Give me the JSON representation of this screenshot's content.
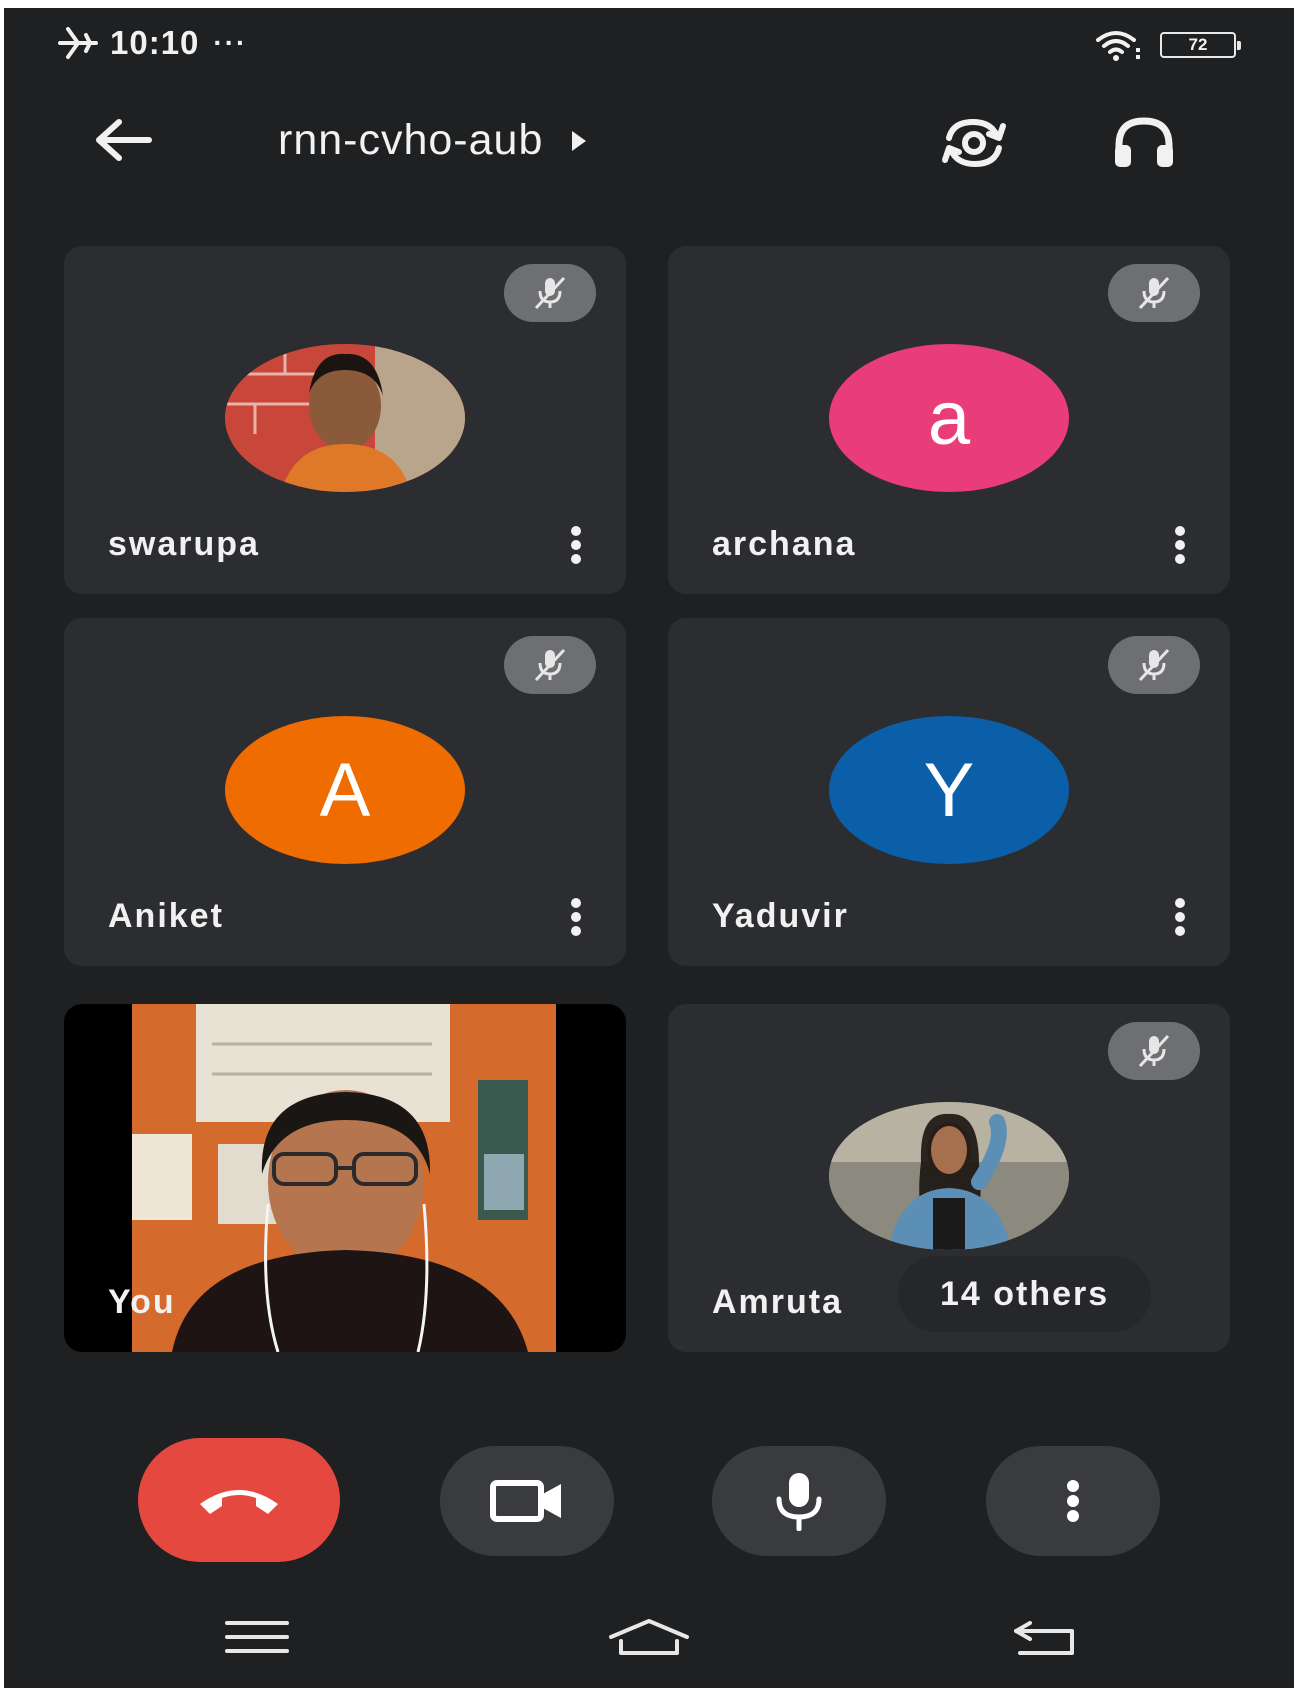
{
  "status_bar": {
    "time": "10:10",
    "overflow_dots": "···",
    "battery_level": "72",
    "icons": [
      "airplane-icon",
      "wifi-icon",
      "battery-icon"
    ]
  },
  "header": {
    "meeting_code": "rnn-cvho-aub",
    "icons": [
      "back-arrow-icon",
      "play-triangle-icon",
      "switch-camera-icon",
      "headphones-icon"
    ]
  },
  "participants": [
    {
      "name": "swarupa",
      "avatar_type": "photo",
      "muted": true
    },
    {
      "name": "archana",
      "avatar_type": "letter",
      "initial": "a",
      "avatar_color": "#e83d78",
      "muted": true
    },
    {
      "name": "Aniket",
      "avatar_type": "letter",
      "initial": "A",
      "avatar_color": "#ef6c00",
      "muted": true
    },
    {
      "name": "Yaduvir",
      "avatar_type": "letter",
      "initial": "Y",
      "avatar_color": "#0b5ea8",
      "muted": true
    },
    {
      "name": "You",
      "avatar_type": "live-video",
      "muted": false
    },
    {
      "name": "Amruta",
      "avatar_type": "photo",
      "muted": true
    }
  ],
  "others_chip": "14 others",
  "controls": {
    "end_call_color": "#e5483f",
    "icons": [
      "end-call-icon",
      "video-camera-icon",
      "microphone-icon",
      "more-vert-icon"
    ]
  },
  "nav_bar": {
    "icons": [
      "menu-icon",
      "home-icon",
      "back-icon"
    ]
  },
  "colors": {
    "background": "#1f2022",
    "tile": "#2c2d30",
    "mute_badge": "#6e6f72",
    "control_button": "#3a3b3e"
  }
}
